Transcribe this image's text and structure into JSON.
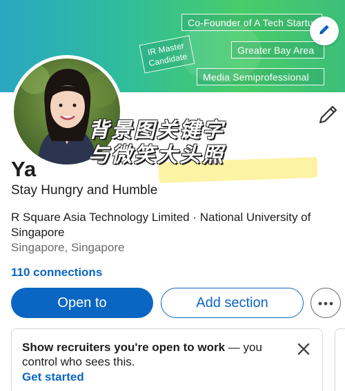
{
  "banner": {
    "tags": {
      "founder": "Co-Founder of A Tech Startup",
      "ir": "IR Master Candidate",
      "bay": "Greater Bay Area",
      "media": "Media Semiprofessional"
    },
    "edit_icon": "pencil-icon"
  },
  "overlay": {
    "line1": "背景图关键字",
    "line2": "与微笑大头照"
  },
  "profile": {
    "name": "Ya",
    "headline": "Stay Hungry and Humble",
    "company": "R Square Asia Technology Limited · National University of Singapore",
    "location": "Singapore, Singapore",
    "connections": "110 connections",
    "edit_icon": "pencil-icon"
  },
  "actions": {
    "open_to": "Open to",
    "add_section": "Add section",
    "more_icon": "more-horizontal-icon"
  },
  "open_to_work_card": {
    "bold_text": "Show recruiters you're open to work",
    "rest_text": " — you control who sees this.",
    "cta": "Get started",
    "close_icon": "close-icon"
  },
  "colors": {
    "accent": "#0a66c2",
    "banner_start": "#2aa7c2",
    "banner_end": "#49cc6a",
    "highlight": "#fdf29a"
  }
}
